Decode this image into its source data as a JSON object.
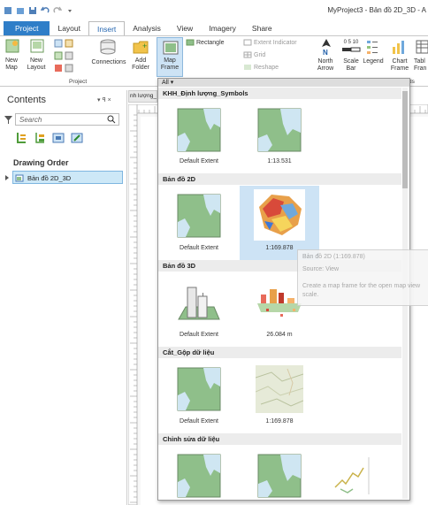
{
  "window": {
    "title": "MyProject3 - Bản đồ 2D_3D - A"
  },
  "tabs": [
    "Project",
    "Layout",
    "Insert",
    "Analysis",
    "View",
    "Imagery",
    "Share"
  ],
  "ribbon": {
    "new_map": "New\nMap",
    "new_layout": "New\nLayout",
    "connections": "Connections",
    "add_folder": "Add\nFolder",
    "project_group": "Project",
    "map_frame": "Map\nFrame",
    "rectangle": "Rectangle",
    "extent_indicator": "Extent Indicator",
    "grid": "Grid",
    "reshape": "Reshape",
    "north_arrow": "North\nArrow",
    "scale_bar": "Scale\nBar",
    "scale_ticks": "0 5 10",
    "legend": "Legend",
    "chart_frame": "Chart\nFrame",
    "table_frame": "Tabl\nFran",
    "elements_group_partial": "ds"
  },
  "contents": {
    "title": "Contents",
    "pane_controls": "▾ ꟼ ×",
    "search_placeholder": "Search",
    "drawing_order": "Drawing Order",
    "map_name": "Bản đồ 2D_3D"
  },
  "map_tab_partial": "nh lượng_",
  "gallery": {
    "filter": "All",
    "sections": [
      {
        "title": "KHH_Định lượng_Symbols",
        "items": [
          {
            "caption": "Default Extent"
          },
          {
            "caption": "1:13.531"
          }
        ]
      },
      {
        "title": "Bản đồ 2D",
        "items": [
          {
            "caption": "Default Extent"
          },
          {
            "caption": "1:169.878"
          }
        ]
      },
      {
        "title": "Bản đồ 3D",
        "items": [
          {
            "caption": "Default Extent"
          },
          {
            "caption": "26.084 m"
          }
        ]
      },
      {
        "title": "Cắt_Gộp dữ liệu",
        "items": [
          {
            "caption": "Default Extent"
          },
          {
            "caption": "1:169.878"
          }
        ]
      },
      {
        "title": "Chỉnh sửa dữ liệu",
        "items": [
          {
            "caption": ""
          },
          {
            "caption": ""
          },
          {
            "caption": ""
          }
        ]
      }
    ]
  },
  "tooltip": {
    "title": "Bản đồ 2D (1:169.878)",
    "source": "Source: View",
    "desc1": "Create a map frame for the open map view",
    "desc2": "scale."
  },
  "colors": {
    "accent": "#2f7ec8",
    "selection": "#cde3f5",
    "map_green": "#8fbf8a",
    "map_water": "#cfe6f2"
  }
}
